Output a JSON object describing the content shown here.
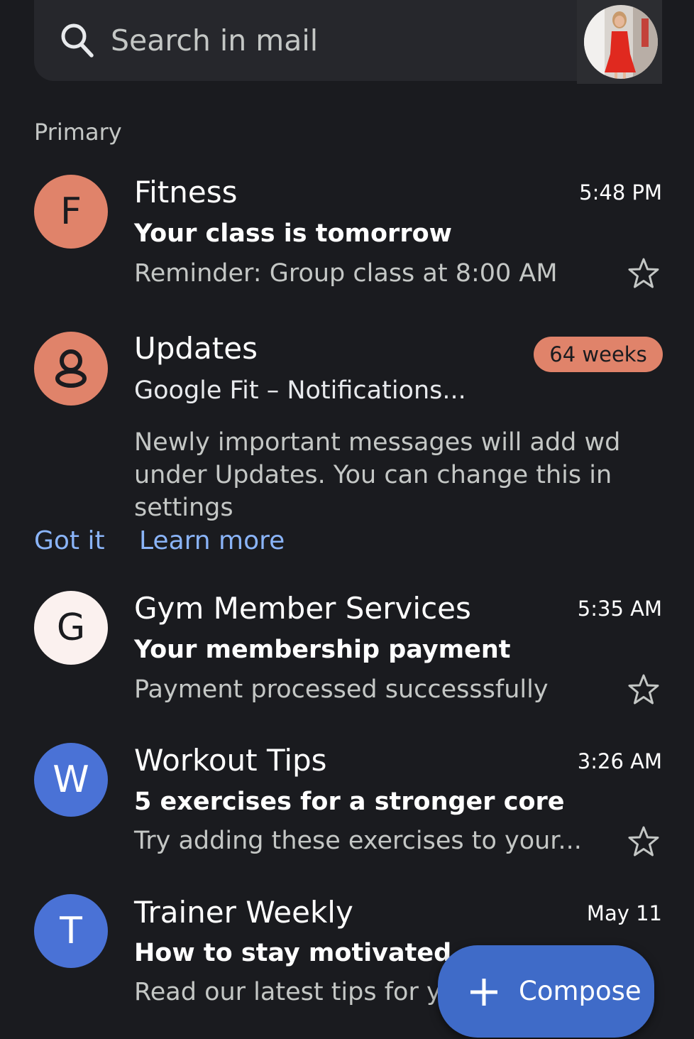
{
  "search": {
    "placeholder": "Search in mail"
  },
  "section": {
    "label": "Primary"
  },
  "mails": [
    {
      "sender": "Fitness",
      "initial": "F",
      "avatar_color": "#e0836a",
      "time": "5:48 PM",
      "subject": "Your class is tomorrow",
      "preview": "Reminder: Group class at 8:00 AM"
    },
    {
      "sender": "Gym Member Services",
      "initial": "G",
      "avatar_color": "#fbf1ef",
      "time": "5:35 AM",
      "subject": "Your membership payment",
      "preview": "Payment processed successsfully"
    },
    {
      "sender": "Workout Tips",
      "initial": "W",
      "avatar_color": "#4a72d6",
      "time": "3:26 AM",
      "subject": "5 exercises for a stronger core",
      "preview": "Try adding these exercises to your..."
    },
    {
      "sender": "Trainer Weekly",
      "initial": "T",
      "avatar_color": "#4a72d6",
      "time": "May 11",
      "subject": "How to stay motivated",
      "preview": "Read our latest tips for you"
    }
  ],
  "updates": {
    "title": "Updates",
    "icon": "updates-icon",
    "badge": "64 weeks",
    "subject": "Google Fit – Notifications...",
    "body": "Newly important messages will add wd under Updates. You can change this in settings",
    "got_it": "Got it",
    "learn_more": "Learn more"
  },
  "compose": {
    "label": "Compose",
    "icon": "plus-icon"
  },
  "colors": {
    "background": "#1a1b1f",
    "accent_link": "#8ab4f8",
    "compose_bg": "#3f6bc8"
  }
}
